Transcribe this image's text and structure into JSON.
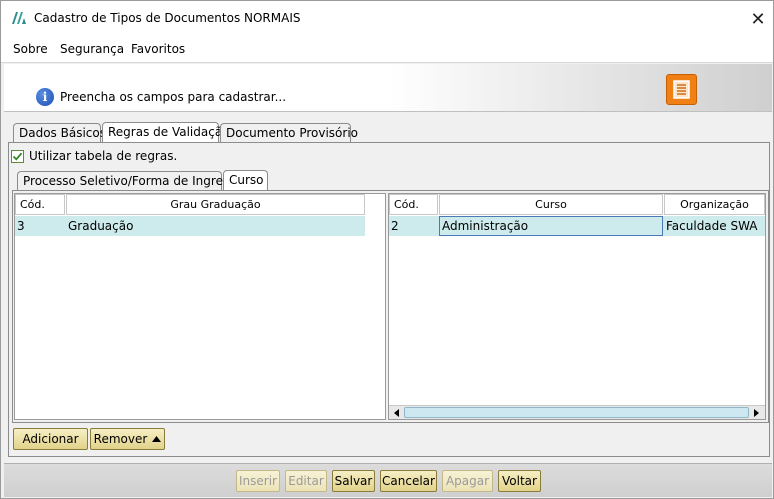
{
  "window": {
    "title": "Cadastro de Tipos de Documentos NORMAIS",
    "close_glyph": "✕"
  },
  "menu": {
    "items": [
      {
        "label": "Sobre"
      },
      {
        "label": "Segurança"
      },
      {
        "label": "Favoritos"
      }
    ]
  },
  "info": {
    "icon_glyph": "i",
    "text": "Preencha os campos para cadastrar..."
  },
  "tabs": {
    "main": [
      {
        "label": "Dados Básicos"
      },
      {
        "label": "Regras de Validação"
      },
      {
        "label": "Documento Provisório"
      }
    ],
    "sub": [
      {
        "label": "Processo Seletivo/Forma de Ingresso"
      },
      {
        "label": "Curso"
      }
    ]
  },
  "rules": {
    "checkbox_label": "Utilizar tabela de regras.",
    "checked": true
  },
  "left_table": {
    "columns": [
      "Cód.",
      "Grau Graduação"
    ],
    "rows": [
      {
        "cod": "3",
        "grau": "Graduação"
      }
    ]
  },
  "right_table": {
    "columns": [
      "Cód.",
      "Curso",
      "Organização"
    ],
    "rows": [
      {
        "cod": "2",
        "curso": "Administração",
        "organizacao": "Faculdade SWA"
      }
    ]
  },
  "grid_buttons": {
    "add": "Adicionar",
    "remove": "Remover"
  },
  "footer": {
    "inserir": "Inserir",
    "editar": "Editar",
    "salvar": "Salvar",
    "cancelar": "Cancelar",
    "apagar": "Apagar",
    "voltar": "Voltar"
  },
  "colors": {
    "selected_row": "#cdeaec",
    "accent_orange": "#f07f14",
    "button_gold": "#e2d28a"
  }
}
